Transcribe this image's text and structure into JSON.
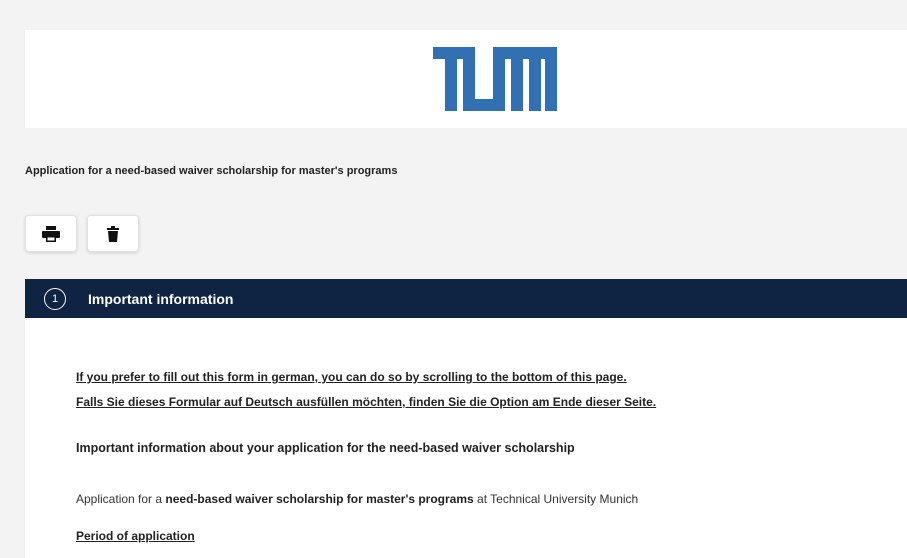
{
  "header": {
    "logo_name": "TUM"
  },
  "form": {
    "title": "Application for a need-based waiver scholarship for master's programs"
  },
  "toolbar": {
    "print_icon": "printer-icon",
    "delete_icon": "trash-icon"
  },
  "section": {
    "step_number": "1",
    "title": "Important information",
    "header_color": "#0f2342"
  },
  "content": {
    "language_note_en": "If you prefer to fill out this form in german, you can do so by scrolling to the bottom of this page.",
    "language_note_de": "Falls Sie dieses Formular auf Deutsch ausfüllen möchten, finden Sie die Option am Ende dieser Seite.",
    "info_heading": "Important information about your application for the need-based waiver scholarship",
    "intro_prefix": "Application for a ",
    "intro_bold": "need-based waiver scholarship for master's programs",
    "intro_suffix": " at Technical University Munich",
    "period_heading": "Period of application"
  },
  "colors": {
    "brand_blue": "#3070b3",
    "background": "#f3f3f3"
  }
}
